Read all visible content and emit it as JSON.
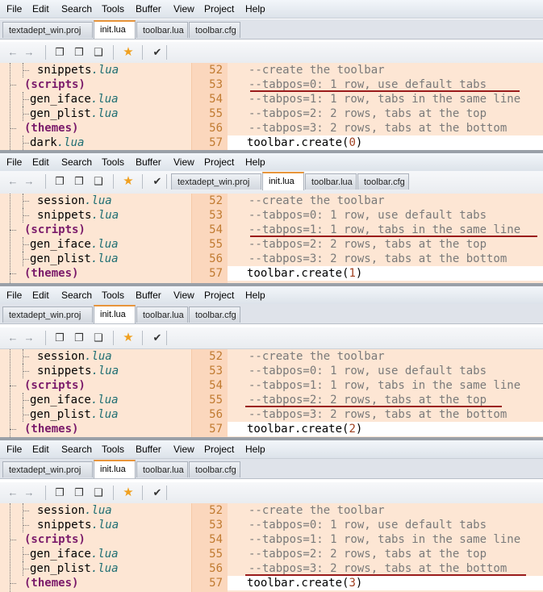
{
  "menu": [
    "File",
    "Edit",
    "Search",
    "Tools",
    "Buffer",
    "View",
    "Project",
    "Help"
  ],
  "tabs": [
    "textadept_win.proj",
    "init.lua",
    "toolbar.lua",
    "toolbar.cfg"
  ],
  "active_tab": "init.lua",
  "toolbar_icons": [
    "back-arrow-icon",
    "forward-arrow-icon",
    "toggle-view-icon",
    "toggle-view-icon",
    "toggle-view-icon",
    "favorite-star-icon",
    "check-icon"
  ],
  "code_lines": [
    {
      "n": "52",
      "t": "--create the toolbar"
    },
    {
      "n": "53",
      "t": "--tabpos=0: 1 row, use default tabs"
    },
    {
      "n": "54",
      "t": "--tabpos=1: 1 row, tabs in the same line"
    },
    {
      "n": "55",
      "t": "--tabpos=2: 2 rows, tabs at the top"
    },
    {
      "n": "56",
      "t": "--tabpos=3: 2 rows, tabs at the bottom"
    },
    {
      "n": "57",
      "t": "toolbar.create(",
      "arg": "0",
      "close": ")"
    }
  ],
  "panels": [
    {
      "tree": [
        {
          "name": "snippets",
          "ext": ".lua",
          "indent": 1
        },
        {
          "name": "(scripts)",
          "ext": "",
          "indent": 0,
          "folder": true
        },
        {
          "name": "gen_iface",
          "ext": ".lua",
          "indent": 1
        },
        {
          "name": "gen_plist",
          "ext": ".lua",
          "indent": 1
        },
        {
          "name": "(themes)",
          "ext": "",
          "indent": 0,
          "folder": true
        },
        {
          "name": "dark",
          "ext": ".lua",
          "indent": 1
        }
      ],
      "create_arg": "0"
    },
    {
      "tree": [
        {
          "name": "session",
          "ext": ".lua",
          "indent": 1
        },
        {
          "name": "snippets",
          "ext": ".lua",
          "indent": 1
        },
        {
          "name": "(scripts)",
          "ext": "",
          "indent": 0,
          "folder": true
        },
        {
          "name": "gen_iface",
          "ext": ".lua",
          "indent": 1
        },
        {
          "name": "gen_plist",
          "ext": ".lua",
          "indent": 1
        },
        {
          "name": "(themes)",
          "ext": "",
          "indent": 0,
          "folder": true
        }
      ],
      "create_arg": "1"
    },
    {
      "tree": [
        {
          "name": "session",
          "ext": ".lua",
          "indent": 1
        },
        {
          "name": "snippets",
          "ext": ".lua",
          "indent": 1
        },
        {
          "name": "(scripts)",
          "ext": "",
          "indent": 0,
          "folder": true
        },
        {
          "name": "gen_iface",
          "ext": ".lua",
          "indent": 1
        },
        {
          "name": "gen_plist",
          "ext": ".lua",
          "indent": 1
        },
        {
          "name": "(themes)",
          "ext": "",
          "indent": 0,
          "folder": true
        }
      ],
      "create_arg": "2"
    },
    {
      "tree": [
        {
          "name": "session",
          "ext": ".lua",
          "indent": 1
        },
        {
          "name": "snippets",
          "ext": ".lua",
          "indent": 1
        },
        {
          "name": "(scripts)",
          "ext": "",
          "indent": 0,
          "folder": true
        },
        {
          "name": "gen_iface",
          "ext": ".lua",
          "indent": 1
        },
        {
          "name": "gen_plist",
          "ext": ".lua",
          "indent": 1
        },
        {
          "name": "(themes)",
          "ext": "",
          "indent": 0,
          "folder": true
        }
      ],
      "create_arg": "3"
    }
  ]
}
